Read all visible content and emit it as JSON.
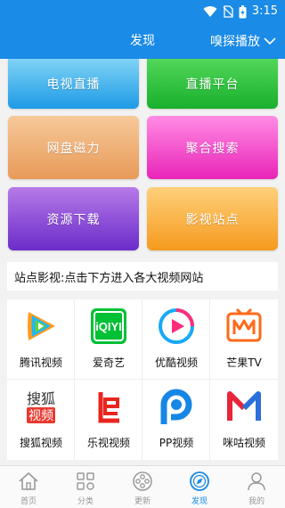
{
  "status_bar": {
    "time": "3:15",
    "icons": [
      "wifi-icon",
      "no-sim-icon",
      "battery-icon"
    ]
  },
  "header": {
    "title": "发现",
    "right_label": "嗅探播放"
  },
  "tiles": [
    {
      "label": "电视直播",
      "colors": [
        "#7fd3f5",
        "#1e9be6"
      ]
    },
    {
      "label": "直播平台",
      "colors": [
        "#52d65a",
        "#18b02c"
      ]
    },
    {
      "label": "网盘磁力",
      "colors": [
        "#f7c99a",
        "#e89a58"
      ]
    },
    {
      "label": "聚合搜索",
      "colors": [
        "#ff8ce4",
        "#e924b8"
      ]
    },
    {
      "label": "资源下载",
      "colors": [
        "#b67ae8",
        "#6a2cc9"
      ]
    },
    {
      "label": "影视站点",
      "colors": [
        "#ffd07a",
        "#f59a1e"
      ]
    }
  ],
  "info": {
    "text": "站点影视:点击下方进入各大视频网站"
  },
  "sites": [
    {
      "label": "腾讯视频",
      "icon": "tencent-video-icon"
    },
    {
      "label": "爱奇艺",
      "icon": "iqiyi-icon"
    },
    {
      "label": "优酷视频",
      "icon": "youku-icon"
    },
    {
      "label": "芒果TV",
      "icon": "mango-tv-icon"
    },
    {
      "label": "搜狐视频",
      "icon": "sohu-video-icon",
      "logo_text": [
        "搜狐",
        "视频"
      ]
    },
    {
      "label": "乐视视频",
      "icon": "letv-icon"
    },
    {
      "label": "PP视频",
      "icon": "pp-video-icon"
    },
    {
      "label": "咪咕视频",
      "icon": "migu-video-icon"
    }
  ],
  "nav": [
    {
      "label": "首页",
      "icon": "home-icon",
      "active": false
    },
    {
      "label": "分类",
      "icon": "category-icon",
      "active": false
    },
    {
      "label": "更新",
      "icon": "update-icon",
      "active": false
    },
    {
      "label": "发现",
      "icon": "discover-icon",
      "active": true
    },
    {
      "label": "我的",
      "icon": "profile-icon",
      "active": false
    }
  ],
  "colors": {
    "primary": "#1a8be6",
    "inactive": "#999999"
  }
}
